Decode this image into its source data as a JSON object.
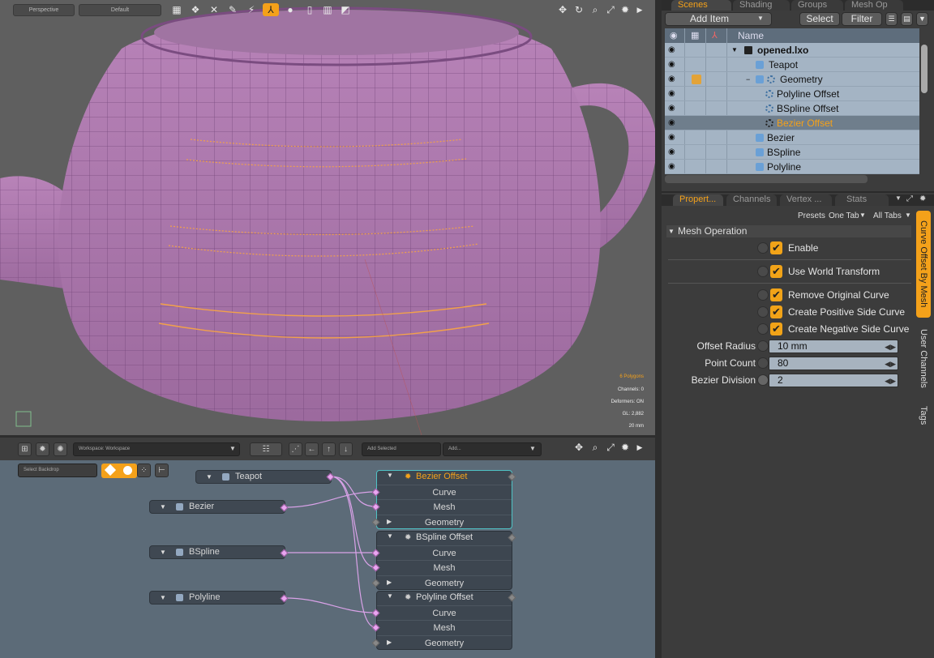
{
  "viewport": {
    "view_mode": "Perspective",
    "style": "Default",
    "info": {
      "polygons": "6 Polygons",
      "channels": "Channels: 0",
      "deformers": "Deformers: ON",
      "gl": "GL: 2,882",
      "scale": "20 mm"
    }
  },
  "node_graph": {
    "workspace": "Workspace: Workspace",
    "add_selected": "Add Selected",
    "add": "Add...",
    "select_backdrop": "Select Backdrop",
    "source_nodes": [
      {
        "label": "Teapot"
      },
      {
        "label": "Bezier"
      },
      {
        "label": "BSpline"
      },
      {
        "label": "Polyline"
      }
    ],
    "op_nodes": [
      {
        "title": "Bezier Offset",
        "rows": [
          "Curve",
          "Mesh",
          "Geometry"
        ]
      },
      {
        "title": "BSpline Offset",
        "rows": [
          "Curve",
          "Mesh",
          "Geometry"
        ]
      },
      {
        "title": "Polyline Offset",
        "rows": [
          "Curve",
          "Mesh",
          "Geometry"
        ]
      }
    ]
  },
  "scenes_panel": {
    "tabs": [
      "Scenes",
      "Shading",
      "Groups",
      "Mesh Op"
    ],
    "add_item": "Add Item",
    "select": "Select",
    "filter": "Filter",
    "column_name": "Name",
    "items": [
      {
        "name": "opened.lxo",
        "icon": "clapper-icon"
      },
      {
        "name": "Teapot",
        "icon": "mesh-icon"
      },
      {
        "name": "Geometry",
        "icon": "mesh-icon"
      },
      {
        "name": "Polyline Offset",
        "icon": "gear-icon"
      },
      {
        "name": "BSpline Offset",
        "icon": "gear-icon"
      },
      {
        "name": "Bezier Offset",
        "icon": "gear-icon"
      },
      {
        "name": "Bezier",
        "icon": "mesh-icon"
      },
      {
        "name": "BSpline",
        "icon": "mesh-icon"
      },
      {
        "name": "Polyline",
        "icon": "mesh-icon"
      }
    ]
  },
  "properties_panel": {
    "tabs": [
      "Propert...",
      "Channels",
      "Vertex ...",
      "Stats"
    ],
    "presets": "Presets",
    "one_tab": "One Tab",
    "all_tabs": "All Tabs",
    "section": "Mesh Operation",
    "checks": [
      {
        "label": "Enable",
        "checked": true
      },
      {
        "label": "Use World Transform",
        "checked": true
      },
      {
        "label": "Remove Original Curve",
        "checked": true
      },
      {
        "label": "Create Positive Side Curve",
        "checked": true
      },
      {
        "label": "Create Negative Side Curve",
        "checked": true
      }
    ],
    "fields": [
      {
        "label": "Offset Radius",
        "value": "10 mm"
      },
      {
        "label": "Point Count",
        "value": "80"
      },
      {
        "label": "Bezier Division",
        "value": "2"
      }
    ],
    "side_tabs": [
      "Curve Offset By Mesh",
      "User Channels",
      "Tags"
    ]
  },
  "colors": {
    "accent": "#f4a11a",
    "mesh": "#b07ab0",
    "node_link": "#d9a2e8",
    "selected_node_border": "#4fc3c6"
  }
}
